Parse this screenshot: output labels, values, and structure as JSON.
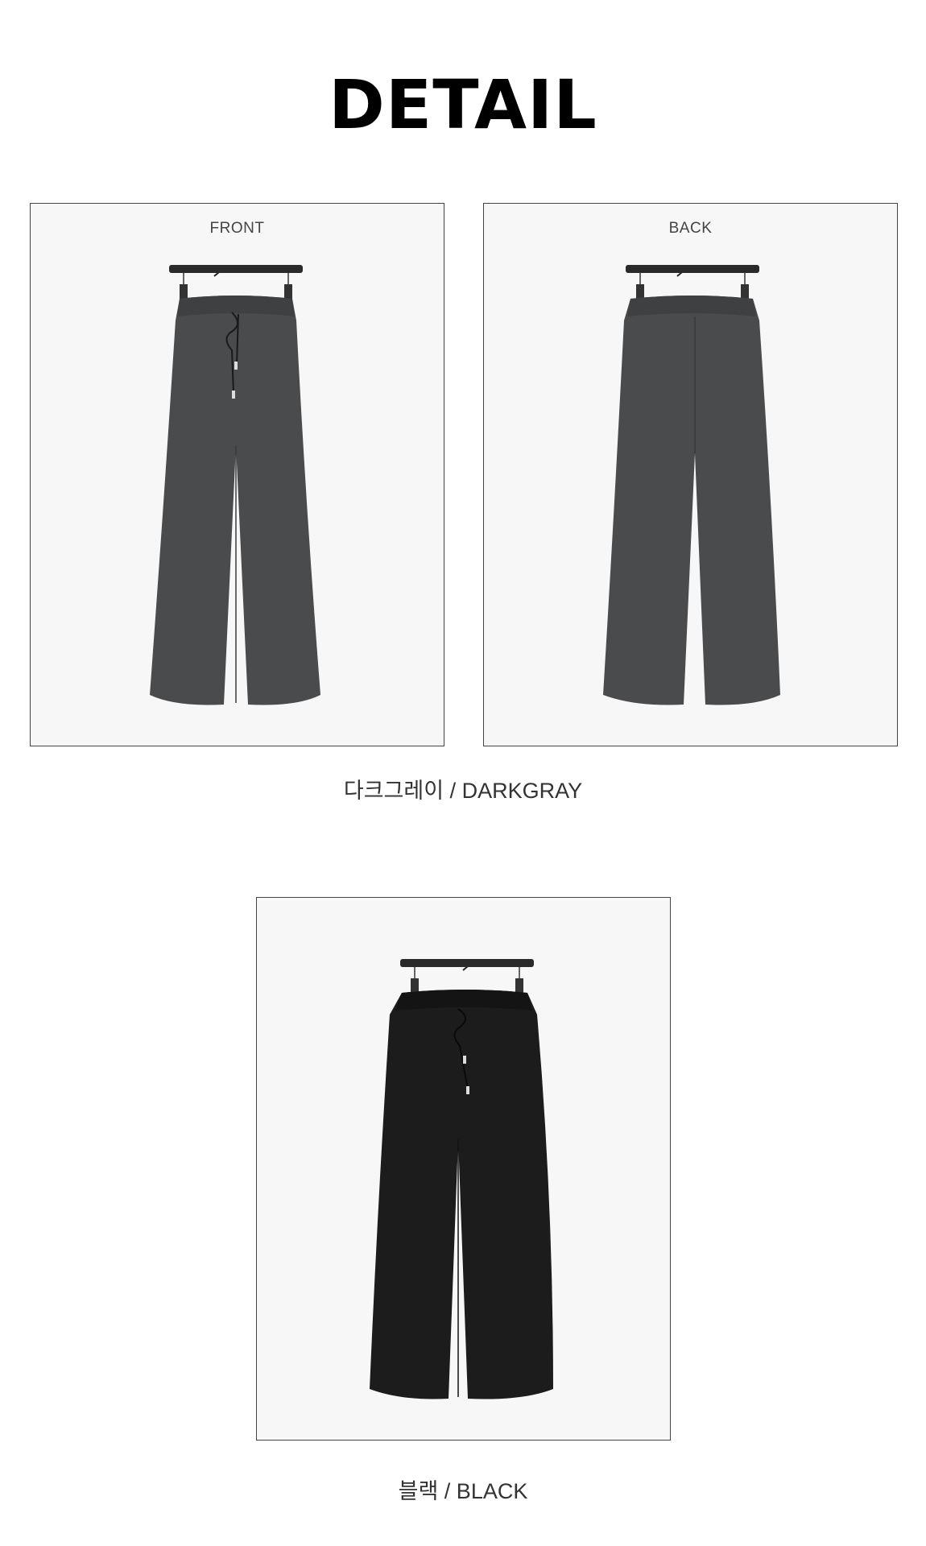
{
  "page": {
    "title": "DETAIL"
  },
  "darkgray": {
    "front_label": "FRONT",
    "back_label": "BACK",
    "caption": "다크그레이 / DARKGRAY",
    "color": "#4a4b4d"
  },
  "black": {
    "caption": "블랙 / BLACK",
    "color": "#1c1c1d"
  }
}
